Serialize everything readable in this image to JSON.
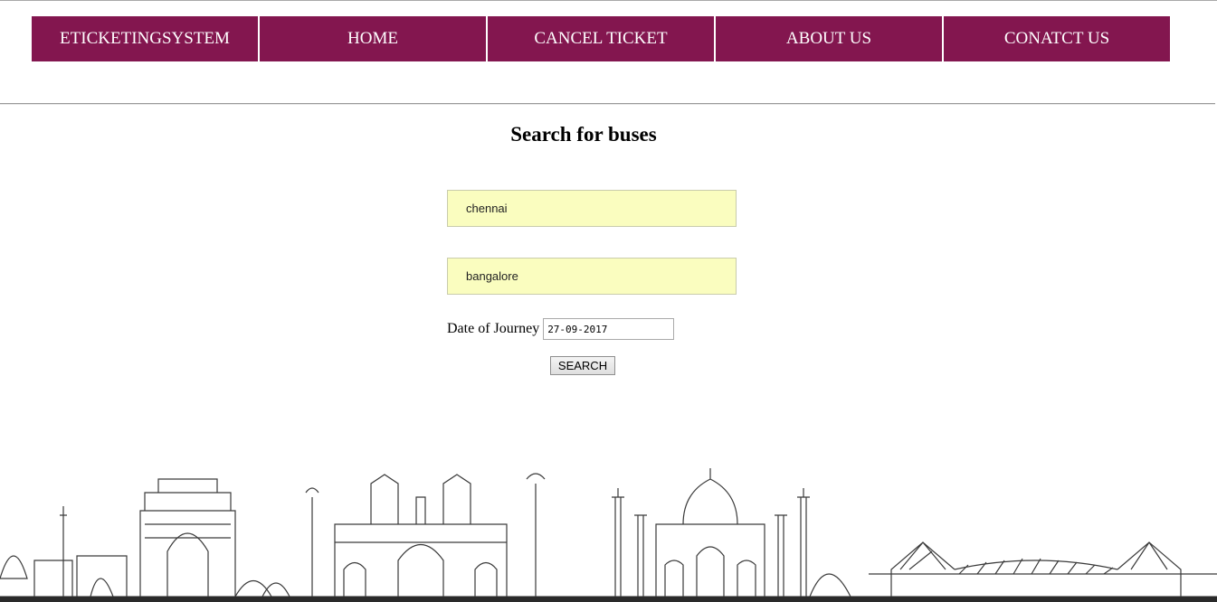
{
  "nav": {
    "items": [
      {
        "label": "ETICKETINGSYSTEM"
      },
      {
        "label": "HOME"
      },
      {
        "label": "CANCEL TICKET"
      },
      {
        "label": "ABOUT US"
      },
      {
        "label": "CONATCT US"
      }
    ]
  },
  "search": {
    "title": "Search for buses",
    "from_value": "chennai",
    "to_value": "bangalore",
    "date_label": "Date of Journey",
    "date_value": "27-09-2017",
    "button_label": "SEARCH"
  },
  "colors": {
    "nav_bg": "#83164f",
    "nav_text": "#ffffff",
    "field_bg": "#fafdbf"
  },
  "footer": {
    "image": "city-skyline-sketch"
  }
}
